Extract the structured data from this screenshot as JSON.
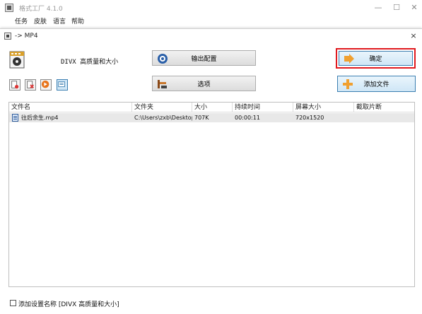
{
  "main_window": {
    "title": "格式工厂 4.1.0",
    "menu": [
      "任务",
      "皮肤",
      "语言",
      "帮助"
    ],
    "minimize": "—",
    "maximize": "☐",
    "close": "✕"
  },
  "dialog": {
    "title": "-> MP4",
    "close": "×",
    "format_label": "DIVX 高质量和大小",
    "buttons": {
      "output_config": "输出配置",
      "options": "选项",
      "ok": "确定",
      "add_file": "添加文件"
    },
    "tool_icons": [
      "clear-list-icon",
      "remove-file-icon",
      "play-icon",
      "view-icon"
    ],
    "columns": [
      "文件名",
      "文件夹",
      "大小",
      "持续时间",
      "屏幕大小",
      "截取片断"
    ],
    "rows": [
      {
        "name": "往后余生.mp4",
        "folder": "C:\\Users\\zxb\\Desktop",
        "size": "707K",
        "duration": "00:00:11",
        "resolution": "720x1520",
        "clip": ""
      }
    ],
    "footer_checkbox_label": "添加设置名称 [DIVX 高质量和大小]",
    "footer_checked": false
  },
  "colors": {
    "highlight_border": "#e0191e",
    "selected_row": "#e8e8e8",
    "ok_button": "#cfe6f6"
  }
}
